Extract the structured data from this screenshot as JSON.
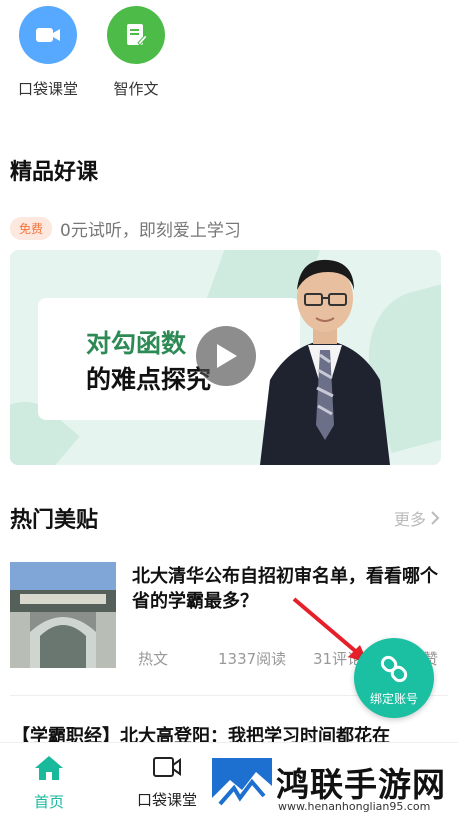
{
  "shortcuts": [
    {
      "label": "口袋课堂",
      "icon": "video-camera-icon",
      "color": "#57a9ff"
    },
    {
      "label": "智作文",
      "icon": "edit-note-icon",
      "color": "#4cbb47"
    }
  ],
  "premium": {
    "title": "精品好课",
    "badge": "免费",
    "tagline": "0元试听，即刻爱上学习",
    "banner_line1": "对勾函数",
    "banner_line2": "的难点探究"
  },
  "hot": {
    "title": "热门美贴",
    "more_label": "更多",
    "article": {
      "title": "北大清华公布自招初审名单，看看哪个省的学霸最多？",
      "tag": "热文",
      "reads": "1337阅读",
      "comments": "31评论",
      "likes_partial": "赞"
    },
    "next_title": "【学霸职经】北大高登阳：我把学习时间都花在"
  },
  "fab": {
    "label": "绑定账号",
    "icon": "link-icon"
  },
  "bottom_nav": [
    {
      "label": "首页",
      "icon": "home-icon",
      "active": true
    },
    {
      "label": "口袋课堂",
      "icon": "video-camera-icon",
      "active": false
    }
  ],
  "watermark": {
    "name": "鸿联手游网",
    "url": "www.henanhonglian95.com"
  },
  "colors": {
    "accent": "#19b99c",
    "free_badge": "#f5733c",
    "arrow": "#e6202a"
  }
}
